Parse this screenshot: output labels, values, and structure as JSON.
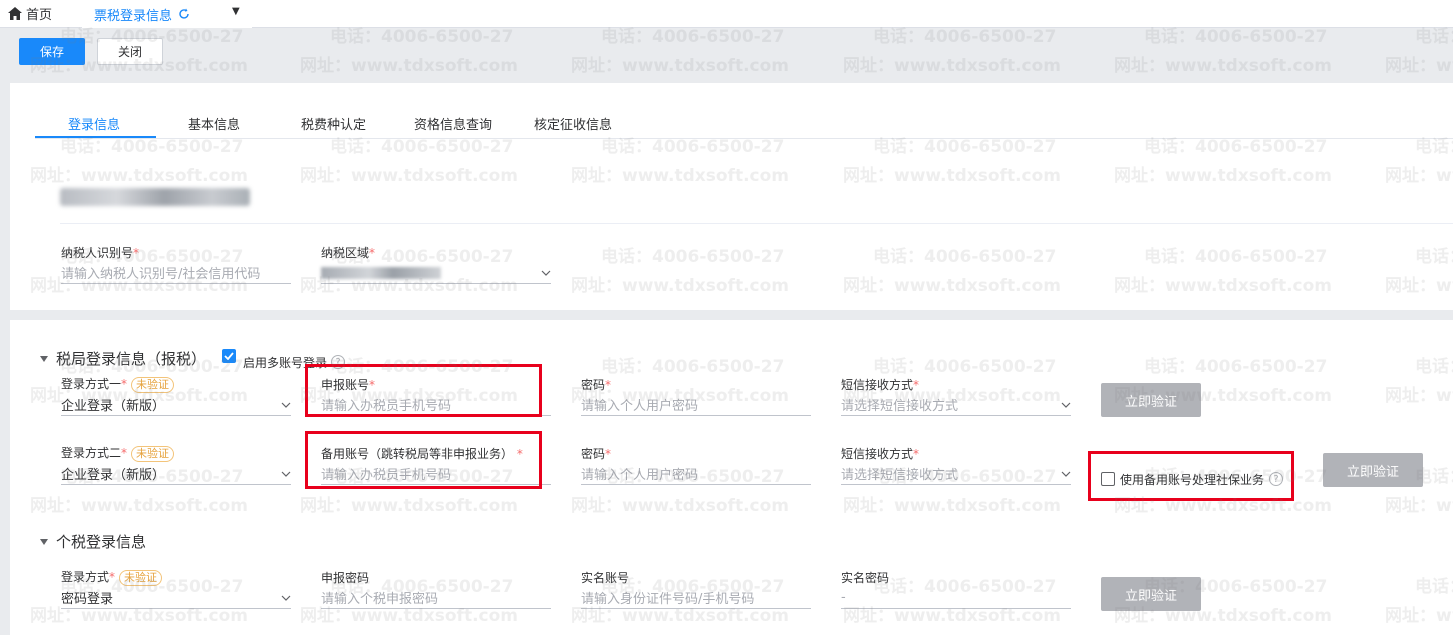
{
  "tabbar": {
    "home_label": "首页",
    "active_tab": "票税登录信息"
  },
  "toolbar": {
    "save_label": "保存",
    "close_label": "关闭"
  },
  "subtabs": [
    "登录信息",
    "基本信息",
    "税费种认定",
    "资格信息查询",
    "核定征收信息"
  ],
  "basic": {
    "taxpayer_id_label": "纳税人识别号",
    "taxpayer_id_placeholder": "请输入纳税人识别号/社会信用代码",
    "region_label": "纳税区域"
  },
  "tax_bureau": {
    "title": "税局登录信息（报税）",
    "multi_account_label": "启用多账号登录",
    "rows": [
      {
        "method_label": "登录方式一",
        "status": "未验证",
        "method_value": "企业登录（新版）",
        "account_label": "申报账号",
        "account_placeholder": "请输入办税员手机号码",
        "password_label": "密码",
        "password_placeholder": "请输入个人用户密码",
        "sms_label": "短信接收方式",
        "sms_placeholder": "请选择短信接收方式",
        "verify_label": "立即验证"
      },
      {
        "method_label": "登录方式二",
        "status": "未验证",
        "method_value": "企业登录（新版）",
        "account_label": "备用账号（跳转税局等非申报业务）",
        "account_placeholder": "请输入办税员手机号码",
        "password_label": "密码",
        "password_placeholder": "请输入个人用户密码",
        "sms_label": "短信接收方式",
        "sms_placeholder": "请选择短信接收方式",
        "backup_social_label": "使用备用账号处理社保业务",
        "verify_label": "立即验证"
      }
    ]
  },
  "personal_tax": {
    "title": "个税登录信息",
    "method_label": "登录方式",
    "status": "未验证",
    "method_value": "密码登录",
    "declare_pwd_label": "申报密码",
    "declare_pwd_placeholder": "请输入个税申报密码",
    "realname_account_label": "实名账号",
    "realname_account_placeholder": "请输入身份证件号码/手机号码",
    "realname_pwd_label": "实名密码",
    "realname_pwd_value": "-",
    "verify_label": "立即验证"
  },
  "watermark": {
    "phone": "电话：4006-6500-27",
    "site": "网址：www.tdxsoft.com"
  },
  "colors": {
    "primary": "#1989fa",
    "warning": "#e6a23c",
    "danger": "#e8001c",
    "disabled_button": "#b1b3b8"
  }
}
